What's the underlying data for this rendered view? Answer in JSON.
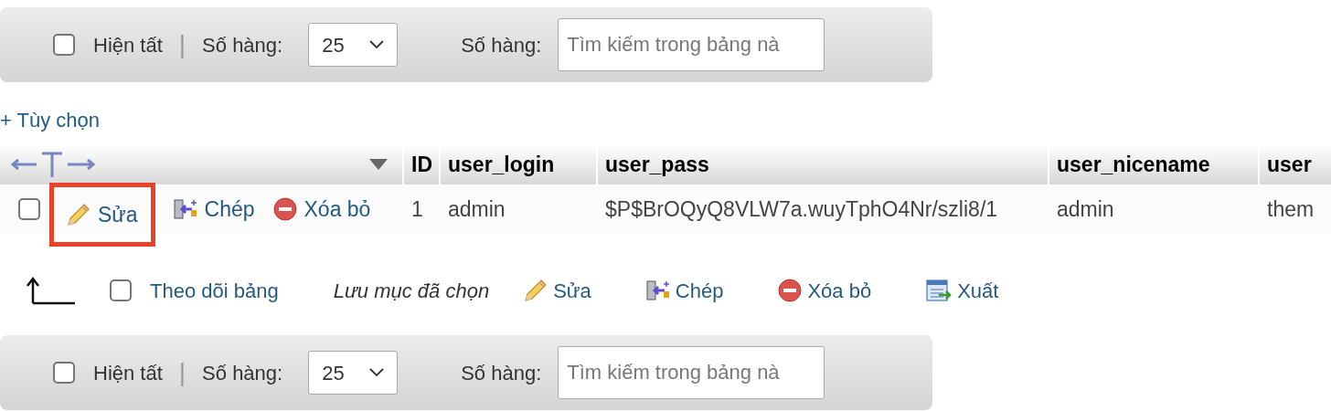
{
  "toolbars": [
    {
      "show_all": {
        "label": "Hiện tất",
        "checked": false
      },
      "separator": "|",
      "rows_label": "Số hàng:",
      "rows_value": "25",
      "search_label": "Số hàng:",
      "search_placeholder": "Tìm kiếm trong bảng nà"
    },
    {
      "show_all": {
        "label": "Hiện tất",
        "checked": false
      },
      "separator": "|",
      "rows_label": "Số hàng:",
      "rows_value": "25",
      "search_label": "Số hàng:",
      "search_placeholder": "Tìm kiếm trong bảng nà"
    }
  ],
  "options_link": "+ Tùy chọn",
  "table": {
    "columns": [
      "ID",
      "user_login",
      "user_pass",
      "user_nicename",
      "user"
    ],
    "rows": [
      {
        "checked": false,
        "actions": [
          {
            "kind": "edit",
            "label": "Sửa",
            "highlighted": true
          },
          {
            "kind": "copy",
            "label": "Chép",
            "highlighted": false
          },
          {
            "kind": "delete",
            "label": "Xóa bỏ",
            "highlighted": false
          }
        ],
        "cells": [
          "1",
          "admin",
          "$P$BrOQyQ8VLW7a.wuyTphO4Nr/szli8/1",
          "admin",
          "them"
        ]
      }
    ]
  },
  "bulk": {
    "check_all": {
      "label": "Theo dõi bảng",
      "checked": false
    },
    "with_selected": "Lưu mục đã chọn",
    "actions": [
      {
        "kind": "edit",
        "label": "Sửa"
      },
      {
        "kind": "copy",
        "label": "Chép"
      },
      {
        "kind": "delete",
        "label": "Xóa bỏ"
      },
      {
        "kind": "export",
        "label": "Xuất"
      }
    ]
  }
}
